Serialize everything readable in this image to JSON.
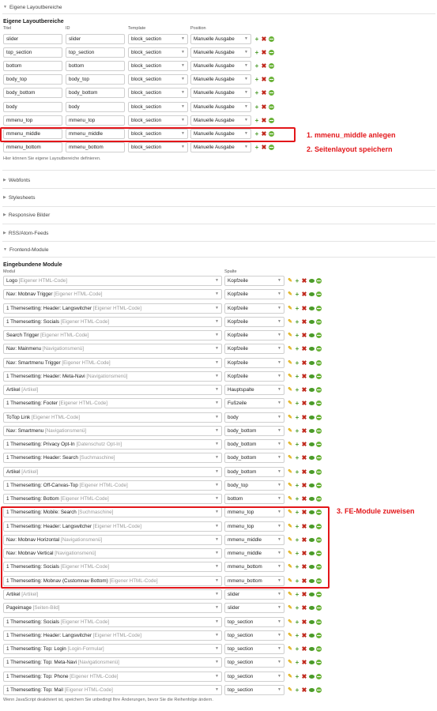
{
  "sections": {
    "layout_header": "Eigene Layoutbereiche",
    "webfonts": "Webfonts",
    "stylesheets": "Stylesheets",
    "responsive": "Responsive Bilder",
    "rss": "RSS/Atom-Feeds",
    "frontend": "Frontend-Module"
  },
  "layout": {
    "title": "Eigene Layoutbereiche",
    "col_titel": "Titel",
    "col_id": "ID",
    "col_template": "Template",
    "col_position": "Position",
    "rows": [
      {
        "titel": "slider",
        "id": "slider",
        "template": "block_section",
        "position": "Manuelle Ausgabe"
      },
      {
        "titel": "top_section",
        "id": "top_section",
        "template": "block_section",
        "position": "Manuelle Ausgabe"
      },
      {
        "titel": "bottom",
        "id": "bottom",
        "template": "block_section",
        "position": "Manuelle Ausgabe"
      },
      {
        "titel": "body_top",
        "id": "body_top",
        "template": "block_section",
        "position": "Manuelle Ausgabe"
      },
      {
        "titel": "body_bottom",
        "id": "body_bottom",
        "template": "block_section",
        "position": "Manuelle Ausgabe"
      },
      {
        "titel": "body",
        "id": "body",
        "template": "block_section",
        "position": "Manuelle Ausgabe"
      },
      {
        "titel": "mmenu_top",
        "id": "mmenu_top",
        "template": "block_section",
        "position": "Manuelle Ausgabe"
      },
      {
        "titel": "mmenu_middle",
        "id": "mmenu_middle",
        "template": "block_section",
        "position": "Manuelle Ausgabe"
      },
      {
        "titel": "mmenu_bottom",
        "id": "mmenu_bottom",
        "template": "block_section",
        "position": "Manuelle Ausgabe"
      }
    ],
    "hint": "Hier können Sie eigene Layoutbereiche definieren."
  },
  "modules": {
    "title": "Eingebundene Module",
    "col_modul": "Modul",
    "col_spalte": "Spalte",
    "rows": [
      {
        "name": "Logo",
        "type": "[Eigener HTML-Code]",
        "column": "Kopfzeile"
      },
      {
        "name": "Nav: Mobnav Trigger",
        "type": "[Eigener HTML-Code]",
        "column": "Kopfzeile"
      },
      {
        "name": "1 Themesetting: Header: Langswitcher",
        "type": "[Eigener HTML-Code]",
        "column": "Kopfzeile"
      },
      {
        "name": "1 Themesetting: Socials",
        "type": "[Eigener HTML-Code]",
        "column": "Kopfzeile"
      },
      {
        "name": "Search Trigger",
        "type": "[Eigener HTML-Code]",
        "column": "Kopfzeile"
      },
      {
        "name": "Nav: Mainmenu",
        "type": "[Navigationsmenü]",
        "column": "Kopfzeile"
      },
      {
        "name": "Nav: Smartmenu Trigger",
        "type": "[Eigener HTML-Code]",
        "column": "Kopfzeile"
      },
      {
        "name": "1 Themesetting: Header: Meta-Navi",
        "type": "[Navigationsmenü]",
        "column": "Kopfzeile"
      },
      {
        "name": "Artikel",
        "type": "[Artikel]",
        "column": "Hauptspalte"
      },
      {
        "name": "1 Themesetting: Footer",
        "type": "[Eigener HTML-Code]",
        "column": "Fußzeile"
      },
      {
        "name": "ToTop Link",
        "type": "[Eigener HTML-Code]",
        "column": "body"
      },
      {
        "name": "Nav: Smartmenu",
        "type": "[Navigationsmenü]",
        "column": "body_bottom"
      },
      {
        "name": "1 Themesetting: Privacy Opt-In",
        "type": "[Datenschutz Opt-In]",
        "column": "body_bottom"
      },
      {
        "name": "1 Themesetting: Header: Search",
        "type": "[Suchmaschine]",
        "column": "body_bottom"
      },
      {
        "name": "Artikel",
        "type": "[Artikel]",
        "column": "body_bottom"
      },
      {
        "name": "1 Themesetting: Off-Canvas-Top",
        "type": "[Eigener HTML-Code]",
        "column": "body_top"
      },
      {
        "name": "1 Themesetting: Bottom",
        "type": "[Eigener HTML-Code]",
        "column": "bottom"
      },
      {
        "name": "1 Themesetting: Mobile: Search",
        "type": "[Suchmaschine]",
        "column": "mmenu_top"
      },
      {
        "name": "1 Themesetting: Header: Langswitcher",
        "type": "[Eigener HTML-Code]",
        "column": "mmenu_top"
      },
      {
        "name": "Nav: Mobnav Horizontal",
        "type": "[Navigationsmenü]",
        "column": "mmenu_middle"
      },
      {
        "name": "Nav: Mobnav Vertical",
        "type": "[Navigationsmenü]",
        "column": "mmenu_middle"
      },
      {
        "name": "1 Themesetting: Socials",
        "type": "[Eigener HTML-Code]",
        "column": "mmenu_bottom"
      },
      {
        "name": "1 Themesetting: Mobnav (Customnav Bottom)",
        "type": "[Eigener HTML-Code]",
        "column": "mmenu_bottom"
      },
      {
        "name": "Artikel",
        "type": "[Artikel]",
        "column": "slider"
      },
      {
        "name": "Pageimage",
        "type": "[Seiten-Bild]",
        "column": "slider"
      },
      {
        "name": "1 Themesetting: Socials",
        "type": "[Eigener HTML-Code]",
        "column": "top_section"
      },
      {
        "name": "1 Themesetting: Header: Langswitcher",
        "type": "[Eigener HTML-Code]",
        "column": "top_section"
      },
      {
        "name": "1 Themesetting: Top: Login",
        "type": "[Login-Formular]",
        "column": "top_section"
      },
      {
        "name": "1 Themesetting: Top: Meta-Navi",
        "type": "[Navigationsmenü]",
        "column": "top_section"
      },
      {
        "name": "1 Themesetting: Top: Phone",
        "type": "[Eigener HTML-Code]",
        "column": "top_section"
      },
      {
        "name": "1 Themesetting: Top: Mail",
        "type": "[Eigener HTML-Code]",
        "column": "top_section"
      }
    ],
    "hint": "Wenn JavaScript deaktiviert ist, speichern Sie unbedingt Ihre Änderungen, bevor Sie die Reihenfolge ändern."
  },
  "annotations": {
    "step1": "1. mmenu_middle anlegen",
    "step2": "2. Seitenlayout speichern",
    "step3": "3. FE-Module zuweisen"
  },
  "colors": {
    "accent_red": "#e3161a",
    "icon_green": "#4b9b2a",
    "icon_red": "#c0281c",
    "edit_yellow": "#e0b21a"
  }
}
